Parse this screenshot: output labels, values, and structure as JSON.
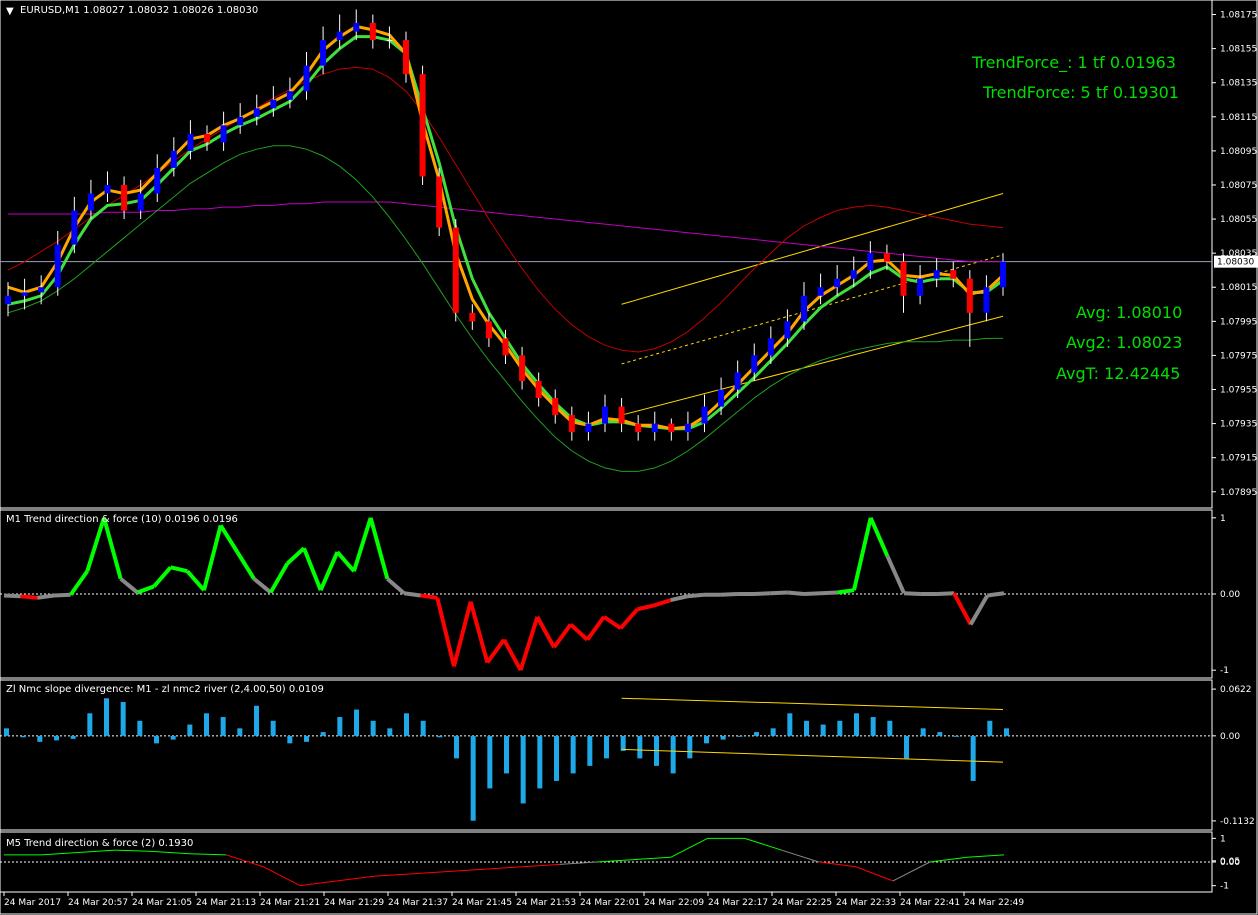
{
  "header": {
    "symbol_info": "EURUSD,M1  1.08027 1.08032 1.08026 1.08030"
  },
  "overlay": {
    "trendforce1": "TrendForce_: 1 tf 0.01963",
    "trendforce2": "TrendForce: 5 tf 0.19301",
    "avg": "Avg: 1.08010",
    "avg2": "Avg2: 1.08023",
    "avgt": "AvgT: 12.42445"
  },
  "colors": {
    "bg": "#000000",
    "grid": "#ffffff",
    "bull": "#0000ff",
    "bear": "#ff0000",
    "doji": "#f5f5dc",
    "ma_orange": "#ffa500",
    "ma_green": "#40e040",
    "ma_red": "#c00000",
    "ma_magenta": "#c000c0",
    "ma_thin_green": "#20a020",
    "channel": "#ffd700",
    "histo": "#1ea8e8",
    "pos": "#00ff00",
    "neg": "#ff0000",
    "neutral": "#888888"
  },
  "chart_data": [
    {
      "type": "candlestick",
      "name": "EURUSD,M1",
      "y_ticks": [
        1.08175,
        1.08155,
        1.08135,
        1.08115,
        1.08095,
        1.08075,
        1.08055,
        1.08035,
        1.08015,
        1.07995,
        1.07975,
        1.07955,
        1.07935,
        1.07915,
        1.07895
      ],
      "ylim": [
        1.07889,
        1.0818
      ],
      "current_price": 1.0803,
      "current_price_label": "1.08030",
      "close": [
        1.0801,
        1.08012,
        1.08015,
        1.0804,
        1.0806,
        1.0807,
        1.08075,
        1.0806,
        1.0807,
        1.08085,
        1.08095,
        1.08105,
        1.081,
        1.0811,
        1.08115,
        1.0812,
        1.08125,
        1.0813,
        1.08145,
        1.0816,
        1.08165,
        1.0817,
        1.0816,
        1.0816,
        1.0814,
        1.0808,
        1.0805,
        1.08,
        1.07995,
        1.07985,
        1.07975,
        1.0796,
        1.0795,
        1.0794,
        1.0793,
        1.07935,
        1.07945,
        1.07935,
        1.0793,
        1.07935,
        1.0793,
        1.07935,
        1.07945,
        1.07955,
        1.07965,
        1.07975,
        1.07985,
        1.07995,
        1.0801,
        1.08015,
        1.0802,
        1.08025,
        1.08035,
        1.0803,
        1.0801,
        1.0802,
        1.08025,
        1.0802,
        1.08,
        1.08015,
        1.0803
      ],
      "open": [
        1.08005,
        1.0801,
        1.08012,
        1.08015,
        1.0804,
        1.0806,
        1.0807,
        1.08075,
        1.0806,
        1.0807,
        1.08085,
        1.08095,
        1.08105,
        1.081,
        1.0811,
        1.08115,
        1.0812,
        1.08125,
        1.0813,
        1.08145,
        1.0816,
        1.08165,
        1.0817,
        1.0816,
        1.0816,
        1.0814,
        1.0808,
        1.0805,
        1.08,
        1.07995,
        1.07985,
        1.07975,
        1.0796,
        1.0795,
        1.0794,
        1.0793,
        1.07935,
        1.07945,
        1.07935,
        1.0793,
        1.07935,
        1.0793,
        1.07935,
        1.07945,
        1.07955,
        1.07965,
        1.07975,
        1.07985,
        1.07995,
        1.0801,
        1.08015,
        1.0802,
        1.08025,
        1.08035,
        1.0803,
        1.0801,
        1.0802,
        1.08025,
        1.0802,
        1.08,
        1.08015
      ],
      "high": [
        1.08018,
        1.0802,
        1.08022,
        1.08048,
        1.08068,
        1.08078,
        1.08083,
        1.0808,
        1.08078,
        1.08093,
        1.08103,
        1.08113,
        1.0811,
        1.08118,
        1.08123,
        1.08128,
        1.08133,
        1.08138,
        1.08153,
        1.08168,
        1.08175,
        1.08178,
        1.08175,
        1.08168,
        1.08165,
        1.08145,
        1.08085,
        1.08055,
        1.08005,
        1.08,
        1.0799,
        1.0798,
        1.07965,
        1.07955,
        1.07945,
        1.07942,
        1.07952,
        1.0795,
        1.0794,
        1.07942,
        1.07938,
        1.07942,
        1.07952,
        1.07962,
        1.07972,
        1.07982,
        1.07992,
        1.08002,
        1.08018,
        1.08023,
        1.08028,
        1.08033,
        1.08042,
        1.0804,
        1.08035,
        1.08028,
        1.08032,
        1.0803,
        1.08025,
        1.08022,
        1.08035
      ],
      "low": [
        1.07998,
        1.08002,
        1.08005,
        1.0801,
        1.08035,
        1.08055,
        1.08065,
        1.08055,
        1.08055,
        1.08065,
        1.0808,
        1.0809,
        1.08095,
        1.08095,
        1.08105,
        1.0811,
        1.08115,
        1.0812,
        1.08125,
        1.0814,
        1.08155,
        1.0816,
        1.08155,
        1.08155,
        1.08135,
        1.08075,
        1.08045,
        1.07995,
        1.0799,
        1.0798,
        1.0797,
        1.07955,
        1.07945,
        1.07935,
        1.07925,
        1.07925,
        1.0793,
        1.0793,
        1.07925,
        1.07925,
        1.07925,
        1.07925,
        1.0793,
        1.0794,
        1.0795,
        1.0796,
        1.0797,
        1.0798,
        1.0799,
        1.08005,
        1.0801,
        1.08015,
        1.0802,
        1.08025,
        1.08,
        1.08005,
        1.08015,
        1.08015,
        1.0798,
        1.07995,
        1.0801
      ],
      "series": [
        {
          "role": "ma_orange",
          "values": [
            1.08015,
            1.08012,
            1.08015,
            1.0803,
            1.0805,
            1.08065,
            1.08072,
            1.0807,
            1.08072,
            1.08082,
            1.08092,
            1.08102,
            1.08104,
            1.0811,
            1.08114,
            1.08119,
            1.08124,
            1.08129,
            1.0814,
            1.08154,
            1.08162,
            1.08168,
            1.08166,
            1.08163,
            1.08152,
            1.08112,
            1.08078,
            1.08035,
            1.08008,
            1.07993,
            1.07981,
            1.07967,
            1.07955,
            1.07945,
            1.07936,
            1.07934,
            1.07938,
            1.07937,
            1.07934,
            1.07934,
            1.07932,
            1.07933,
            1.07939,
            1.07948,
            1.07958,
            1.07968,
            1.07978,
            1.07988,
            1.08001,
            1.0801,
            1.08016,
            1.08022,
            1.0803,
            1.08031,
            1.08022,
            1.08021,
            1.08023,
            1.08022,
            1.08011,
            1.08013,
            1.08022
          ]
        },
        {
          "role": "ma_green",
          "values": [
            1.08005,
            1.08007,
            1.0801,
            1.08022,
            1.0804,
            1.08055,
            1.08063,
            1.08064,
            1.08066,
            1.08075,
            1.08085,
            1.08095,
            1.08099,
            1.08105,
            1.0811,
            1.08114,
            1.08119,
            1.08124,
            1.08134,
            1.08146,
            1.08155,
            1.08162,
            1.08162,
            1.0816,
            1.08152,
            1.0812,
            1.08088,
            1.0805,
            1.0802,
            1.08,
            1.07985,
            1.0797,
            1.07958,
            1.07947,
            1.07938,
            1.07934,
            1.07936,
            1.07936,
            1.07934,
            1.07933,
            1.07932,
            1.07932,
            1.07936,
            1.07944,
            1.07953,
            1.07962,
            1.07972,
            1.07982,
            1.07993,
            1.08003,
            1.0801,
            1.08016,
            1.08023,
            1.08027,
            1.0802,
            1.08018,
            1.0802,
            1.0802,
            1.08012,
            1.08012,
            1.08019
          ]
        },
        {
          "role": "ma_red",
          "values": [
            1.08025,
            1.0803,
            1.08036,
            1.08042,
            1.08049,
            1.08056,
            1.08063,
            1.08069,
            1.08075,
            1.08082,
            1.08089,
            1.08096,
            1.08102,
            1.08108,
            1.08114,
            1.0812,
            1.08126,
            1.08131,
            1.08136,
            1.0814,
            1.08143,
            1.08144,
            1.08143,
            1.08138,
            1.0813,
            1.08118,
            1.08103,
            1.08087,
            1.08071,
            1.08055,
            1.0804,
            1.08026,
            1.08013,
            1.08002,
            1.07993,
            1.07986,
            1.07981,
            1.07978,
            1.07977,
            1.07979,
            1.07983,
            1.07989,
            1.07997,
            1.08006,
            1.08016,
            1.08026,
            1.08035,
            1.08044,
            1.08051,
            1.08056,
            1.0806,
            1.08062,
            1.08063,
            1.08062,
            1.0806,
            1.08058,
            1.08056,
            1.08054,
            1.08052,
            1.08051,
            1.0805
          ]
        },
        {
          "role": "ma_magenta",
          "values": [
            1.08058,
            1.08058,
            1.08058,
            1.08058,
            1.08058,
            1.08058,
            1.08059,
            1.08059,
            1.08059,
            1.0806,
            1.0806,
            1.08061,
            1.08061,
            1.08062,
            1.08062,
            1.08063,
            1.08063,
            1.08064,
            1.08064,
            1.08065,
            1.08065,
            1.08065,
            1.08065,
            1.08065,
            1.08064,
            1.08063,
            1.08062,
            1.08061,
            1.0806,
            1.08059,
            1.08058,
            1.08057,
            1.08056,
            1.08055,
            1.08054,
            1.08053,
            1.08052,
            1.08051,
            1.0805,
            1.08049,
            1.08048,
            1.08047,
            1.08046,
            1.08045,
            1.08044,
            1.08043,
            1.08042,
            1.08041,
            1.0804,
            1.08039,
            1.08038,
            1.08037,
            1.08036,
            1.08035,
            1.08034,
            1.08033,
            1.08032,
            1.08031,
            1.0803,
            1.0803,
            1.0803
          ]
        },
        {
          "role": "ma_thin_green",
          "values": [
            1.08,
            1.08003,
            1.08007,
            1.08013,
            1.0802,
            1.08028,
            1.08036,
            1.08044,
            1.08052,
            1.0806,
            1.08068,
            1.08076,
            1.08082,
            1.08088,
            1.08093,
            1.08096,
            1.08098,
            1.08098,
            1.08096,
            1.08092,
            1.08086,
            1.08078,
            1.08068,
            1.08056,
            1.08043,
            1.08029,
            1.08014,
            1.07999,
            1.07985,
            1.07972,
            1.0796,
            1.07948,
            1.07937,
            1.07927,
            1.07919,
            1.07913,
            1.07909,
            1.07907,
            1.07907,
            1.07909,
            1.07913,
            1.07919,
            1.07926,
            1.07934,
            1.07942,
            1.0795,
            1.07957,
            1.07963,
            1.07968,
            1.07972,
            1.07975,
            1.07978,
            1.0798,
            1.07982,
            1.07983,
            1.07983,
            1.07983,
            1.07984,
            1.07984,
            1.07985,
            1.07985
          ]
        }
      ]
    },
    {
      "type": "line",
      "name": "M1 Trend direction & force (10) 0.0196 0.0196",
      "y_ticks_labels": [
        "1",
        "0.00",
        "-1"
      ],
      "y_ticks": [
        1,
        0,
        -1
      ],
      "ylim": [
        -1.05,
        1.05
      ],
      "values": [
        -0.02,
        -0.03,
        -0.05,
        -0.02,
        -0.01,
        0.3,
        1.0,
        0.2,
        0.02,
        0.1,
        0.35,
        0.3,
        0.05,
        0.9,
        0.55,
        0.2,
        0.02,
        0.4,
        0.6,
        0.05,
        0.55,
        0.3,
        1.0,
        0.2,
        0.01,
        -0.02,
        -0.05,
        -0.95,
        -0.1,
        -0.9,
        -0.6,
        -1.0,
        -0.3,
        -0.7,
        -0.4,
        -0.6,
        -0.3,
        -0.45,
        -0.2,
        -0.15,
        -0.08,
        -0.03,
        -0.01,
        -0.01,
        0.0,
        0.0,
        0.01,
        0.02,
        0.0,
        0.01,
        0.02,
        0.05,
        1.0,
        0.5,
        0.01,
        0.0,
        0.0,
        0.01,
        -0.4,
        -0.02,
        0.01
      ]
    },
    {
      "type": "bar",
      "name": "Zl Nmc slope divergence:  M1 - zl nmc2 river  (2,4.00,50) 0.0109",
      "y_ticks_labels": [
        "0.0622",
        "0.00",
        "-0.1132"
      ],
      "y_ticks": [
        0.0622,
        0,
        -0.1132
      ],
      "ylim": [
        -0.12,
        0.069
      ],
      "values": [
        0.01,
        -0.002,
        -0.008,
        -0.006,
        -0.004,
        0.03,
        0.05,
        0.045,
        0.02,
        -0.01,
        -0.005,
        0.015,
        0.03,
        0.025,
        0.01,
        0.04,
        0.02,
        -0.01,
        -0.008,
        0.005,
        0.025,
        0.035,
        0.02,
        0.01,
        0.03,
        0.02,
        -0.002,
        -0.03,
        -0.113,
        -0.07,
        -0.05,
        -0.09,
        -0.07,
        -0.06,
        -0.05,
        -0.04,
        -0.03,
        -0.02,
        -0.03,
        -0.04,
        -0.05,
        -0.03,
        -0.01,
        -0.005,
        0.0,
        0.005,
        0.01,
        0.03,
        0.02,
        0.015,
        0.02,
        0.03,
        0.025,
        0.02,
        -0.03,
        0.01,
        0.005,
        0.0,
        -0.06,
        0.02,
        0.01
      ]
    },
    {
      "type": "line",
      "name": "M5 Trend direction & force (2) 0.1930",
      "y_ticks_labels": [
        "1",
        "0.05",
        "0.00",
        "-1"
      ],
      "y_ticks": [
        1,
        0.05,
        0,
        -1
      ],
      "ylim": [
        -1.1,
        1.1
      ],
      "values": [
        0.3,
        0.3,
        0.4,
        0.5,
        0.45,
        0.35,
        0.3,
        -0.2,
        -1.0,
        -0.8,
        -0.6,
        -0.5,
        -0.4,
        -0.3,
        -0.2,
        -0.1,
        0.0,
        0.1,
        0.2,
        1.0,
        1.0,
        0.5,
        0.0,
        -0.2,
        -0.8,
        0.0,
        0.2,
        0.3
      ]
    }
  ],
  "x_labels": [
    "24 Mar 2017",
    "24 Mar 20:57",
    "24 Mar 21:05",
    "24 Mar 21:13",
    "24 Mar 21:21",
    "24 Mar 21:29",
    "24 Mar 21:37",
    "24 Mar 21:45",
    "24 Mar 21:53",
    "24 Mar 22:01",
    "24 Mar 22:09",
    "24 Mar 22:17",
    "24 Mar 22:25",
    "24 Mar 22:33",
    "24 Mar 22:41",
    "24 Mar 22:49"
  ]
}
